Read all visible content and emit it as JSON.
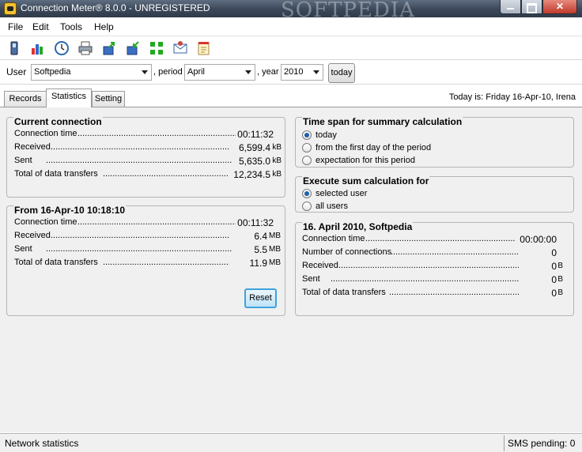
{
  "window": {
    "title": "Connection Meter® 8.0.0 - UNREGISTERED",
    "watermark": "SOFTPEDIA"
  },
  "menu": [
    "File",
    "Edit",
    "Tools",
    "Help"
  ],
  "toolbar_icons": [
    "phone-icon",
    "bar-chart-icon",
    "clock-icon",
    "print-icon",
    "export-icon",
    "import-icon",
    "network-icon",
    "mail-icon",
    "notes-icon"
  ],
  "user_row": {
    "user_label": "User",
    "user_value": "Softpedia",
    "period_label": ", period",
    "period_value": "April",
    "year_label": ", year",
    "year_value": "2010",
    "today_button": "today"
  },
  "tabs": [
    "Records",
    "Statistics",
    "Setting"
  ],
  "active_tab": "Statistics",
  "today_is": "Today is:  Friday 16-Apr-10, Irena",
  "current_connection": {
    "title": "Current connection",
    "rows": [
      {
        "label": "Connection time",
        "value": "00:11:32",
        "unit": ""
      },
      {
        "label": "Received",
        "value": "6,599.4",
        "unit": "kB"
      },
      {
        "label": "Sent",
        "value": "5,635.0",
        "unit": "kB"
      },
      {
        "label": "Total of data transfers",
        "value": "12,234.5",
        "unit": "kB"
      }
    ]
  },
  "from_group": {
    "title": "From 16-Apr-10 10:18:10",
    "rows": [
      {
        "label": "Connection time",
        "value": "00:11:32",
        "unit": ""
      },
      {
        "label": "Received",
        "value": "6.4",
        "unit": "MB"
      },
      {
        "label": "Sent",
        "value": "5.5",
        "unit": "MB"
      },
      {
        "label": "Total of data transfers",
        "value": "11.9",
        "unit": "MB"
      }
    ],
    "reset_button": "Reset"
  },
  "timespan": {
    "title": "Time span for summary calculation",
    "options": [
      "today",
      "from the first day of the period",
      "expectation for this period"
    ],
    "selected": 0
  },
  "execute": {
    "title": "Execute sum calculation for",
    "options": [
      "selected user",
      "all users"
    ],
    "selected": 0
  },
  "summary": {
    "title": "16. April 2010, Softpedia",
    "rows": [
      {
        "label": "Connection time",
        "value": "00:00:00",
        "unit": ""
      },
      {
        "label": "Number of connections",
        "value": "0",
        "unit": ""
      },
      {
        "label": "Received",
        "value": "0",
        "unit": "B"
      },
      {
        "label": "Sent",
        "value": "0",
        "unit": "B"
      },
      {
        "label": "Total of data transfers",
        "value": "0",
        "unit": "B"
      }
    ]
  },
  "status": {
    "left": "Network statistics",
    "right": "SMS pending: 0"
  }
}
